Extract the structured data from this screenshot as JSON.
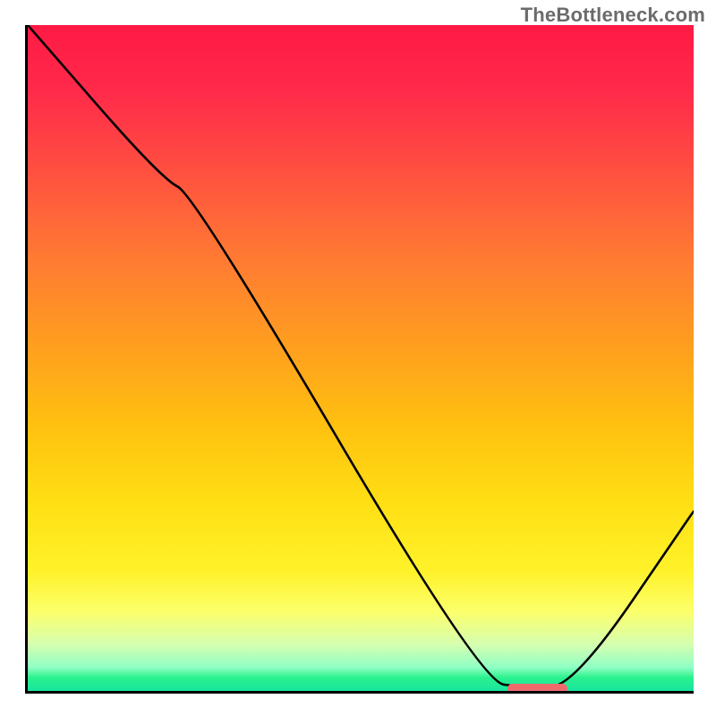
{
  "watermark": "TheBottleneck.com",
  "chart_data": {
    "type": "line",
    "title": "",
    "xlabel": "",
    "ylabel": "",
    "xlim": [
      0,
      100
    ],
    "ylim": [
      0,
      100
    ],
    "x": [
      0,
      20,
      25,
      68,
      75,
      82,
      100
    ],
    "values": [
      100,
      77,
      74.5,
      1.4,
      0.5,
      0.7,
      27
    ],
    "marker": {
      "x_start": 72,
      "x_end": 81,
      "y": 0.4
    },
    "background_gradient_top": "#ff1a45",
    "background_gradient_bottom": "#18e5a0"
  }
}
